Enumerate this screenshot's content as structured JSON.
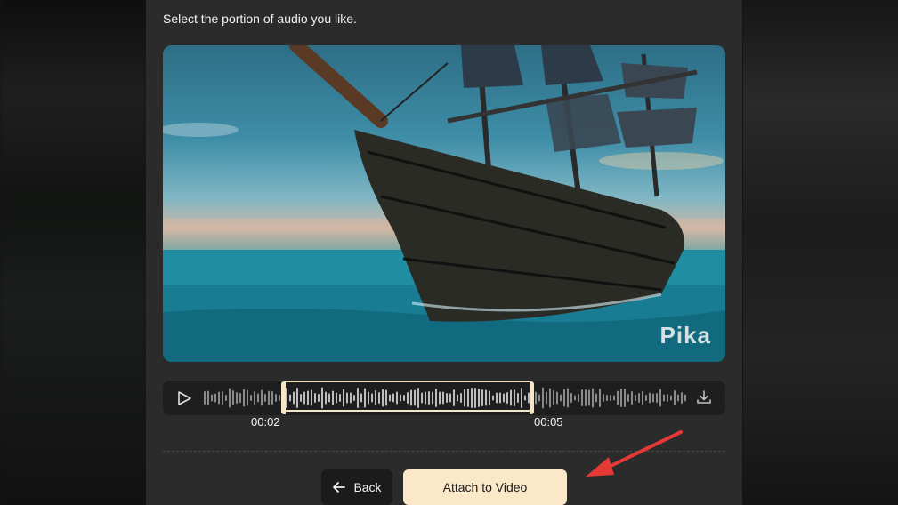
{
  "dialog": {
    "prompt": "Select the portion of audio you like."
  },
  "video": {
    "watermark": "Pika",
    "subject": "pirate-ship-at-sea"
  },
  "audio_trimmer": {
    "play_icon": "play-icon",
    "download_icon": "download-icon",
    "selection_start": "00:02",
    "selection_end": "00:05",
    "selection_color": "#f5e6c8"
  },
  "actions": {
    "back_label": "Back",
    "back_icon": "arrow-left-icon",
    "attach_label": "Attach to Video",
    "attach_color": "#fbe8c9"
  },
  "annotation": {
    "arrow_color": "#e53935"
  }
}
